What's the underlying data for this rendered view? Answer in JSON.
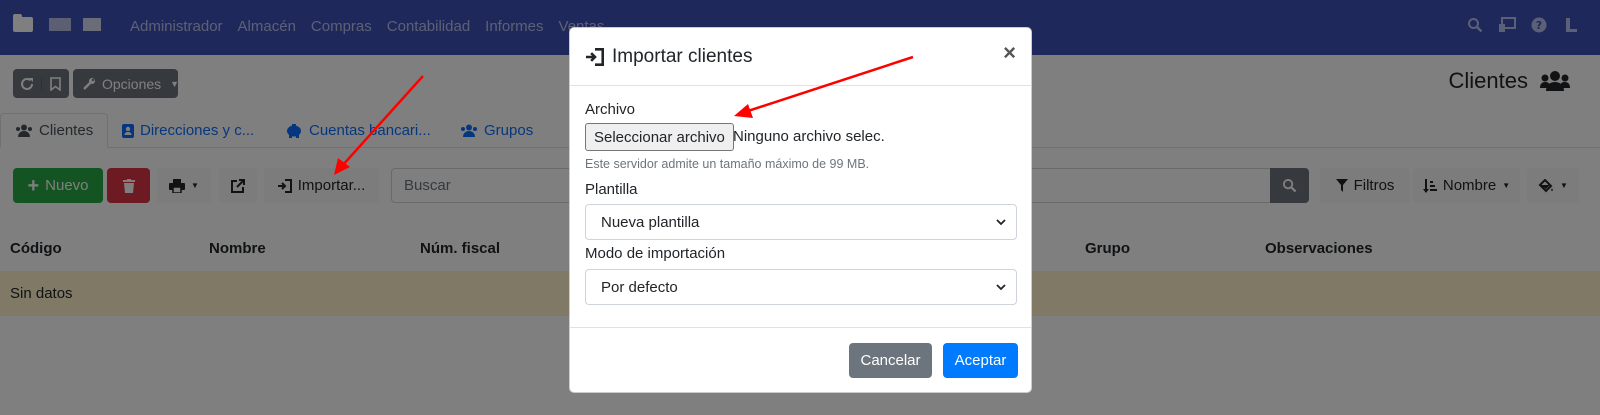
{
  "navbar": {
    "menu": [
      "Administrador",
      "Almacén",
      "Compras",
      "Contabilidad",
      "Informes",
      "Ventas"
    ],
    "icons": [
      "search-icon",
      "screen-icon",
      "help-icon",
      "user-icon"
    ]
  },
  "toolbar": {
    "options_label": "Opciones"
  },
  "page": {
    "title": "Clientes"
  },
  "tabs": [
    {
      "label": "Clientes",
      "icon": "users-icon"
    },
    {
      "label": "Direcciones y c...",
      "icon": "address-book-icon"
    },
    {
      "label": "Cuentas bancari...",
      "icon": "piggy-bank-icon"
    },
    {
      "label": "Grupos",
      "icon": "users-icon"
    }
  ],
  "actions": {
    "new_label": "Nuevo",
    "import_label": "Importar...",
    "search_placeholder": "Buscar",
    "filters_label": "Filtros",
    "sort_label": "Nombre"
  },
  "table": {
    "headers": [
      "Código",
      "Nombre",
      "Núm. fiscal",
      "Grupo",
      "Observaciones"
    ],
    "empty_text": "Sin datos"
  },
  "modal": {
    "title": "Importar clientes",
    "close_symbol": "×",
    "file_label": "Archivo",
    "file_button": "Seleccionar archivo",
    "file_status": "Ninguno archivo selec.",
    "file_help": "Este servidor admite un tamaño máximo de 99 MB.",
    "template_label": "Plantilla",
    "template_value": "Nueva plantilla",
    "mode_label": "Modo de importación",
    "mode_value": "Por defecto",
    "cancel_label": "Cancelar",
    "accept_label": "Aceptar"
  },
  "colors": {
    "navbar": "#3f51b5",
    "success": "#28a745",
    "danger": "#dc3545",
    "primary": "#007bff",
    "secondary": "#6c757d",
    "empty_row": "#fff3cd",
    "arrow": "#ff0000"
  }
}
